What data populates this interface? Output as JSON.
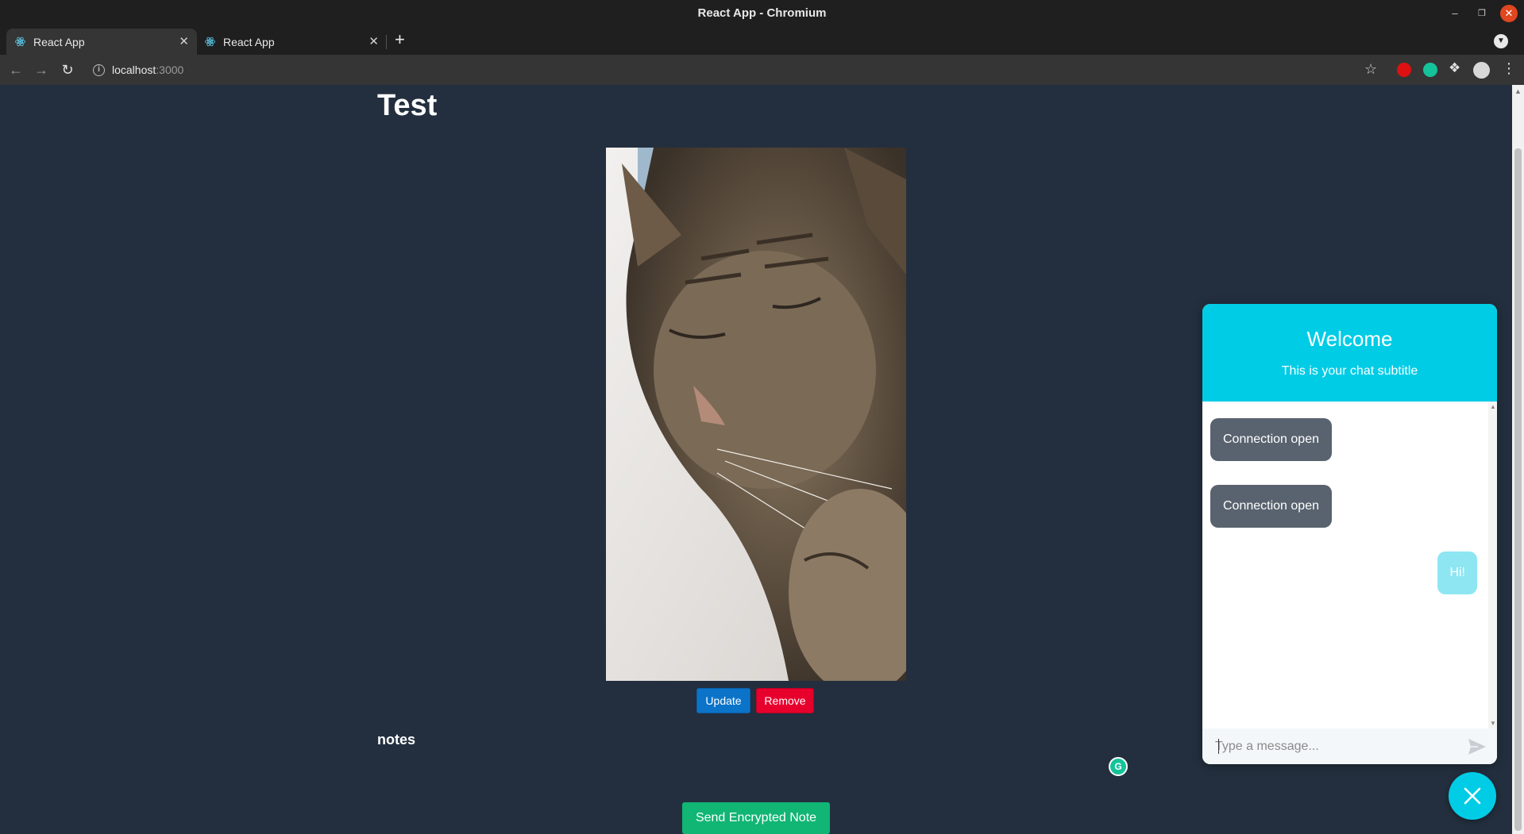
{
  "window": {
    "title": "React App - Chromium"
  },
  "tabs": [
    {
      "title": "React App",
      "active": true
    },
    {
      "title": "React App",
      "active": false
    }
  ],
  "address_bar": {
    "host": "localhost",
    "port": ":3000"
  },
  "page": {
    "title": "Test",
    "image_subject": "sleeping tabby cat",
    "update_label": "Update",
    "remove_label": "Remove",
    "notes_label": "notes",
    "send_label": "Send Encrypted Note"
  },
  "chat": {
    "title": "Welcome",
    "subtitle": "This is your chat subtitle",
    "messages": [
      {
        "from": "bot",
        "text": "Connection open"
      },
      {
        "from": "bot",
        "text": "Connection open"
      },
      {
        "from": "user",
        "text": "Hi!"
      }
    ],
    "input_placeholder": "Type a message..."
  },
  "colors": {
    "page_bg": "#232f3e",
    "chat_accent": "#00cce6",
    "update_btn": "#0b74c9",
    "remove_btn": "#e8002d",
    "send_btn": "#11b574"
  }
}
